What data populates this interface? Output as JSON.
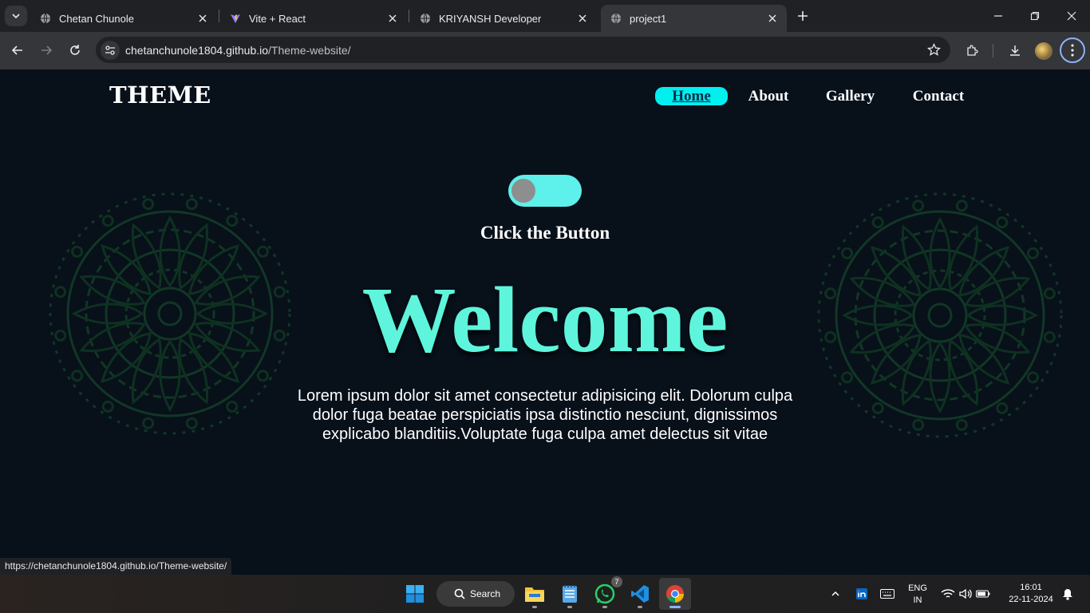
{
  "browser": {
    "tabs": [
      {
        "title": "Chetan Chunole",
        "icon": "globe-icon"
      },
      {
        "title": "Vite + React",
        "icon": "vite-icon"
      },
      {
        "title": "KRIYANSH Developer",
        "icon": "globe-icon"
      },
      {
        "title": "project1",
        "icon": "globe-icon",
        "active": true
      }
    ],
    "url_host": "chetanchunole1804.github.io",
    "url_path": "/Theme-website/",
    "status_url": "https://chetanchunole1804.github.io/Theme-website/"
  },
  "site": {
    "logo": "THEME",
    "nav": [
      "Home",
      "About",
      "Gallery",
      "Contact"
    ],
    "active_nav": "Home",
    "toggle_label": "Click the Button",
    "heading": "Welcome",
    "paragraph": "Lorem ipsum dolor sit amet consectetur adipisicing elit. Dolorum culpa dolor fuga beatae perspiciatis ipsa distinctio nesciunt, dignissimos explicabo blanditiis.Voluptate fuga culpa amet delectus sit vitae",
    "colors": {
      "accent": "#5ef5dc",
      "nav_active_bg": "#00f0f0",
      "background": "#08101a",
      "mandala": "#123a26"
    }
  },
  "taskbar": {
    "search_label": "Search",
    "whatsapp_badge": "7",
    "lang_line1": "ENG",
    "lang_line2": "IN",
    "time": "16:01",
    "date": "22-11-2024"
  }
}
